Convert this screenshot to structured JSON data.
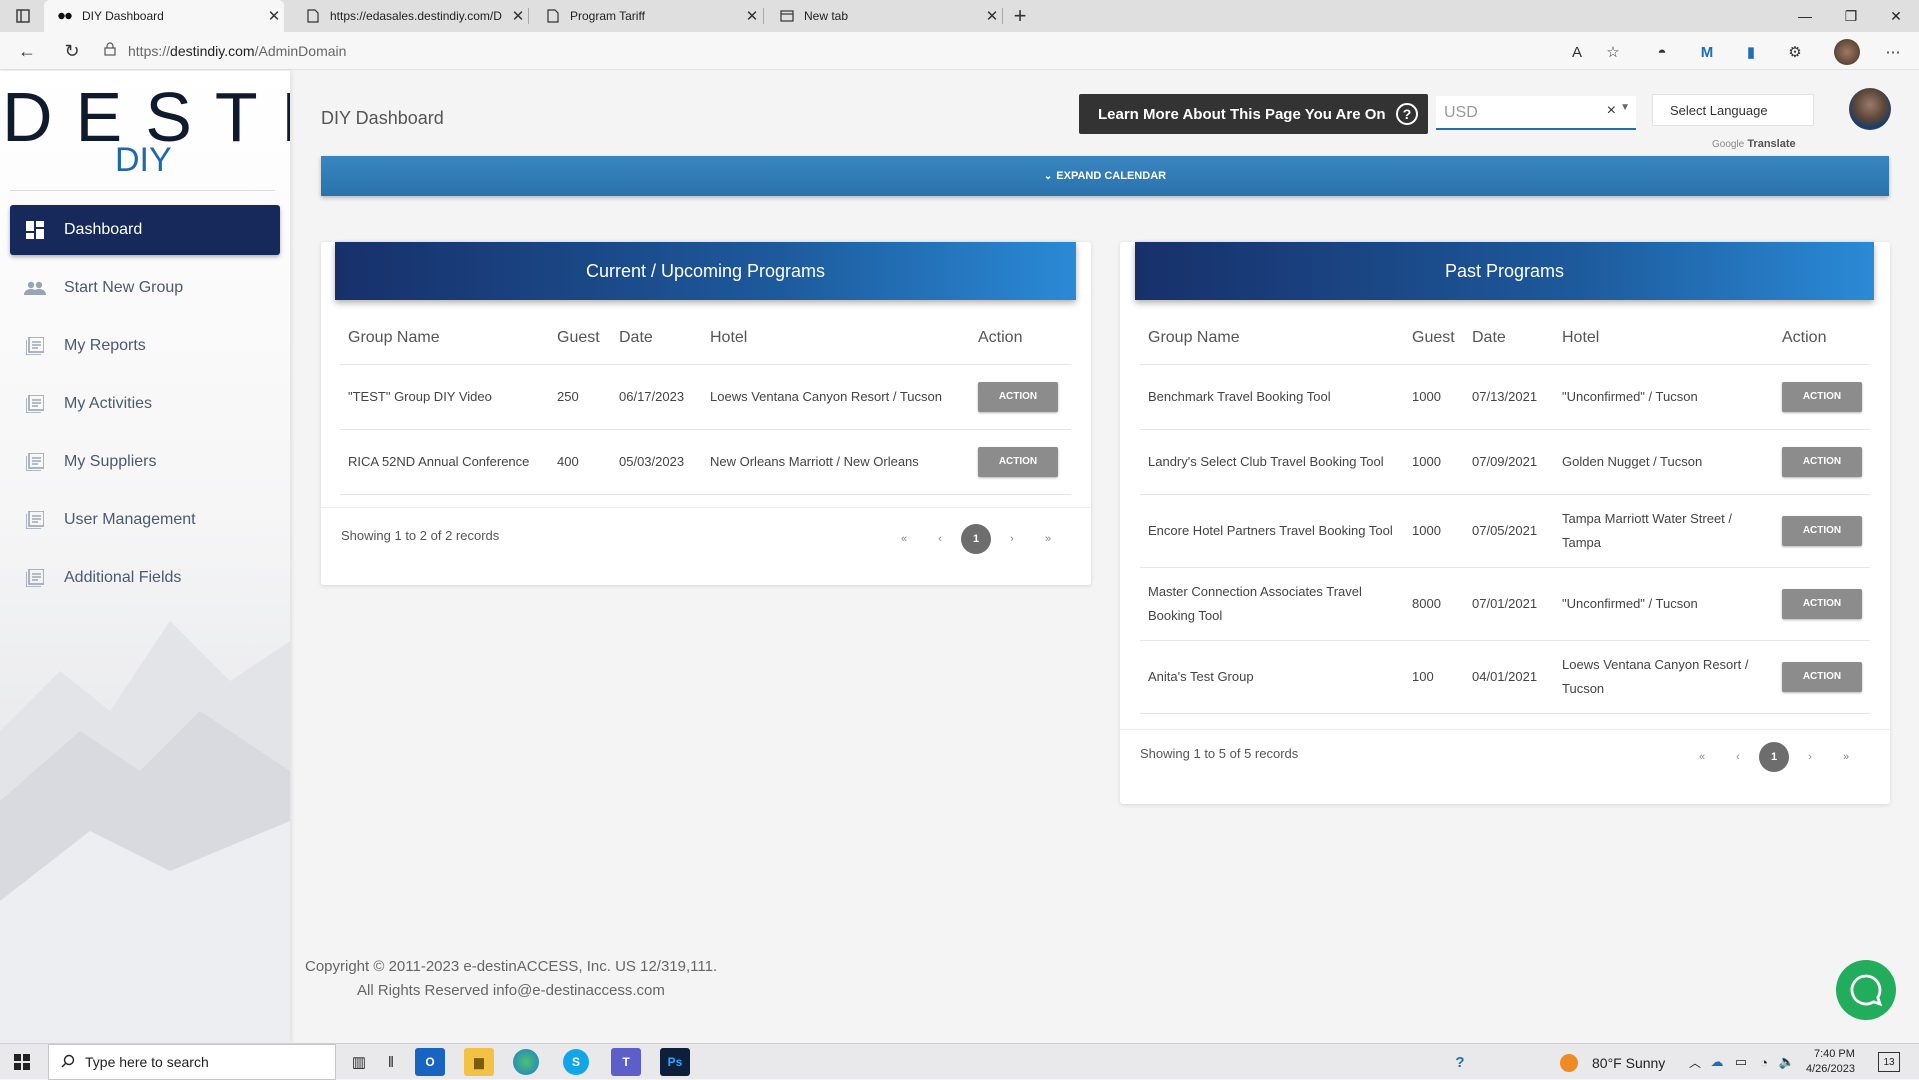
{
  "browser": {
    "tabs": [
      {
        "title": "DIY Dashboard",
        "active": true
      },
      {
        "title": "https://edasales.destindiy.com/D",
        "active": false
      },
      {
        "title": "Program Tariff",
        "active": false
      },
      {
        "title": "New tab",
        "active": false
      }
    ],
    "url": {
      "prefix": "https://",
      "host": "destindiy.com",
      "path": "/AdminDomain"
    }
  },
  "sidebar": {
    "logo": "DESTIN",
    "logo_sub": "DIY",
    "items": [
      {
        "label": "Dashboard",
        "icon": "dashboard-icon",
        "active": true
      },
      {
        "label": "Start New Group",
        "icon": "people-icon"
      },
      {
        "label": "My Reports",
        "icon": "list-icon"
      },
      {
        "label": "My Activities",
        "icon": "list-icon"
      },
      {
        "label": "My Suppliers",
        "icon": "list-icon"
      },
      {
        "label": "User Management",
        "icon": "list-icon"
      },
      {
        "label": "Additional Fields",
        "icon": "list-icon"
      }
    ]
  },
  "header": {
    "title": "DIY Dashboard",
    "learn_more": "Learn More About This Page You Are On",
    "currency": "USD",
    "language": "Select Language",
    "google": "Google",
    "translate": "Translate"
  },
  "calendar": {
    "label": "EXPAND CALENDAR"
  },
  "current": {
    "title": "Current / Upcoming Programs",
    "columns": [
      "Group Name",
      "Guest",
      "Date",
      "Hotel",
      "Action"
    ],
    "rows": [
      {
        "name": "\"TEST\" Group DIY Video",
        "guest": "250",
        "date": "06/17/2023",
        "hotel": "Loews Ventana Canyon Resort / Tucson",
        "action": "ACTION"
      },
      {
        "name": "RICA 52ND Annual Conference",
        "guest": "400",
        "date": "05/03/2023",
        "hotel": "New Orleans Marriott / New Orleans",
        "action": "ACTION"
      }
    ],
    "showing": "Showing 1 to 2 of 2 records",
    "page": "1"
  },
  "past": {
    "title": "Past Programs",
    "columns": [
      "Group Name",
      "Guest",
      "Date",
      "Hotel",
      "Action"
    ],
    "rows": [
      {
        "name": "Benchmark Travel Booking Tool",
        "guest": "1000",
        "date": "07/13/2021",
        "hotel": "\"Unconfirmed\" / Tucson",
        "action": "ACTION"
      },
      {
        "name": "Landry's Select Club Travel Booking Tool",
        "guest": "1000",
        "date": "07/09/2021",
        "hotel": "Golden Nugget / Tucson",
        "action": "ACTION"
      },
      {
        "name": "Encore Hotel Partners Travel Booking Tool",
        "guest": "1000",
        "date": "07/05/2021",
        "hotel": "Tampa Marriott Water Street / Tampa",
        "action": "ACTION"
      },
      {
        "name": "Master Connection Associates Travel Booking Tool",
        "guest": "8000",
        "date": "07/01/2021",
        "hotel": "\"Unconfirmed\" / Tucson",
        "action": "ACTION"
      },
      {
        "name": "Anita's Test Group",
        "guest": "100",
        "date": "04/01/2021",
        "hotel": "Loews Ventana Canyon Resort / Tucson",
        "action": "ACTION"
      }
    ],
    "showing": "Showing 1 to 5 of 5 records",
    "page": "1"
  },
  "footer": {
    "line1": "Copyright © 2011-2023 e-destinACCESS, Inc. US 12/319,111.",
    "line2": "All Rights Reserved info@e-destinaccess.com"
  },
  "taskbar": {
    "search_placeholder": "Type here to search",
    "weather": "80°F  Sunny",
    "time": "7:40 PM",
    "date": "4/26/2023",
    "notifications": "13"
  },
  "colors": {
    "accent": "#16295a",
    "bar": "#2a72ad",
    "chat": "#22ad5c"
  }
}
